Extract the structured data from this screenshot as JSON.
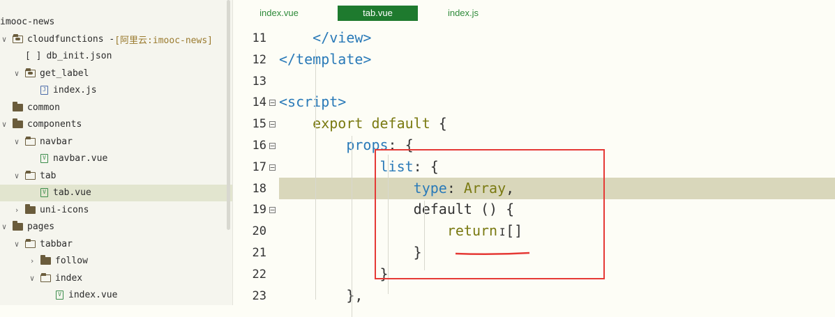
{
  "sidebar": {
    "items": [
      {
        "label": "imooc-news",
        "indent": 0,
        "icon": "none",
        "chevron": "",
        "extra": ""
      },
      {
        "label": "cloudfunctions - ",
        "indent": 0,
        "icon": "cloud-folder-icon",
        "chevron": "v",
        "extra": "[阿里云:imooc-news]"
      },
      {
        "label": "db_init.json",
        "indent": 1,
        "icon": "json-file-icon",
        "chevron": "",
        "extra": ""
      },
      {
        "label": "get_label",
        "indent": 1,
        "icon": "cloud-folder-icon",
        "chevron": "v",
        "extra": ""
      },
      {
        "label": "index.js",
        "indent": 2,
        "icon": "js-file-icon",
        "chevron": "",
        "extra": ""
      },
      {
        "label": "common",
        "indent": 0,
        "icon": "folder-icon",
        "chevron": "",
        "extra": ""
      },
      {
        "label": "components",
        "indent": 0,
        "icon": "folder-icon",
        "chevron": "v",
        "extra": ""
      },
      {
        "label": "navbar",
        "indent": 1,
        "icon": "folder-open-icon",
        "chevron": "v",
        "extra": ""
      },
      {
        "label": "navbar.vue",
        "indent": 2,
        "icon": "vue-file-icon",
        "chevron": "",
        "extra": ""
      },
      {
        "label": "tab",
        "indent": 1,
        "icon": "folder-open-icon",
        "chevron": "v",
        "extra": ""
      },
      {
        "label": "tab.vue",
        "indent": 2,
        "icon": "vue-file-icon",
        "chevron": "",
        "extra": "",
        "selected": true
      },
      {
        "label": "uni-icons",
        "indent": 1,
        "icon": "folder-icon",
        "chevron": ">",
        "extra": ""
      },
      {
        "label": "pages",
        "indent": 0,
        "icon": "folder-icon",
        "chevron": "v",
        "extra": ""
      },
      {
        "label": "tabbar",
        "indent": 1,
        "icon": "folder-open-icon",
        "chevron": "v",
        "extra": ""
      },
      {
        "label": "follow",
        "indent": 2,
        "icon": "folder-icon",
        "chevron": ">",
        "extra": ""
      },
      {
        "label": "index",
        "indent": 2,
        "icon": "folder-open-icon",
        "chevron": "v",
        "extra": ""
      },
      {
        "label": "index.vue",
        "indent": 3,
        "icon": "vue-file-icon",
        "chevron": "",
        "extra": ""
      }
    ]
  },
  "tabs": [
    {
      "label": "index.vue",
      "active": false
    },
    {
      "label": "tab.vue",
      "active": true
    },
    {
      "label": "index.js",
      "active": false
    }
  ],
  "code": {
    "lines": [
      {
        "num": "11",
        "fold": false,
        "segments": [
          {
            "t": "    ",
            "c": "punct"
          },
          {
            "t": "</view>",
            "c": "kw-tag"
          }
        ]
      },
      {
        "num": "12",
        "fold": false,
        "segments": [
          {
            "t": "</template>",
            "c": "kw-tag"
          }
        ]
      },
      {
        "num": "13",
        "fold": false,
        "segments": []
      },
      {
        "num": "14",
        "fold": true,
        "segments": [
          {
            "t": "<script>",
            "c": "kw-tag"
          }
        ]
      },
      {
        "num": "15",
        "fold": true,
        "segments": [
          {
            "t": "    ",
            "c": "punct"
          },
          {
            "t": "export default",
            "c": "kw-olive"
          },
          {
            "t": " {",
            "c": "punct"
          }
        ]
      },
      {
        "num": "16",
        "fold": true,
        "segments": [
          {
            "t": "        ",
            "c": "punct"
          },
          {
            "t": "props",
            "c": "kw-blue"
          },
          {
            "t": ": {",
            "c": "punct"
          }
        ]
      },
      {
        "num": "17",
        "fold": true,
        "segments": [
          {
            "t": "            ",
            "c": "punct"
          },
          {
            "t": "list",
            "c": "kw-blue"
          },
          {
            "t": ": {",
            "c": "punct"
          }
        ]
      },
      {
        "num": "18",
        "fold": false,
        "segments": [
          {
            "t": "                ",
            "c": "punct"
          },
          {
            "t": "type",
            "c": "kw-blue"
          },
          {
            "t": ": ",
            "c": "punct"
          },
          {
            "t": "Array",
            "c": "kw-olive"
          },
          {
            "t": ",",
            "c": "punct"
          }
        ],
        "highlight": true
      },
      {
        "num": "19",
        "fold": true,
        "segments": [
          {
            "t": "                ",
            "c": "punct"
          },
          {
            "t": "default () {",
            "c": "punct"
          }
        ]
      },
      {
        "num": "20",
        "fold": false,
        "segments": [
          {
            "t": "                    ",
            "c": "punct"
          },
          {
            "t": "return",
            "c": "kw-olive"
          },
          {
            "t": " []",
            "c": "punct"
          }
        ]
      },
      {
        "num": "21",
        "fold": false,
        "segments": [
          {
            "t": "                ",
            "c": "punct"
          },
          {
            "t": "}",
            "c": "punct"
          }
        ]
      },
      {
        "num": "22",
        "fold": false,
        "segments": [
          {
            "t": "            ",
            "c": "punct"
          },
          {
            "t": "}",
            "c": "punct"
          }
        ]
      },
      {
        "num": "23",
        "fold": false,
        "segments": [
          {
            "t": "        ",
            "c": "punct"
          },
          {
            "t": "},",
            "c": "punct"
          }
        ]
      }
    ]
  },
  "annotation": {
    "box_color": "#e53935"
  },
  "colors": {
    "accent": "#1e7a2e",
    "highlight": "#d9d7bb"
  }
}
